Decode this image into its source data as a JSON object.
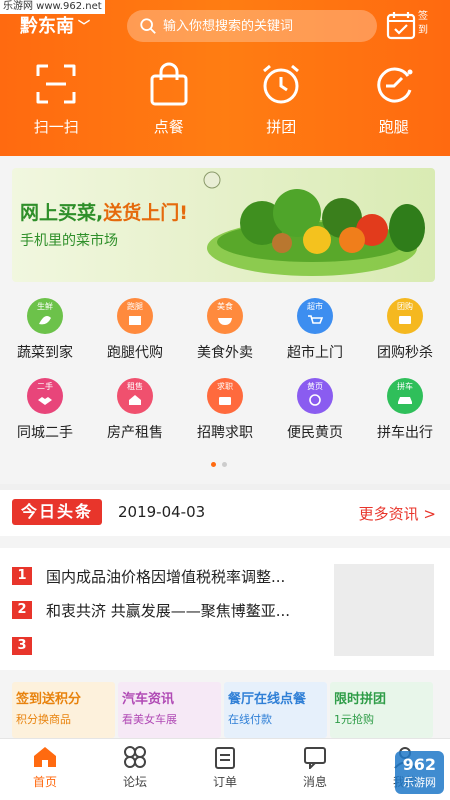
{
  "watermark": "乐游网 www.962.net",
  "header": {
    "city": "黔东南",
    "search_placeholder": "输入你想搜索的关键词",
    "signin_label": "签到",
    "quick_actions": [
      {
        "label": "扫一扫",
        "icon": "scan-icon"
      },
      {
        "label": "点餐",
        "icon": "shopping-bag-icon"
      },
      {
        "label": "拼团",
        "icon": "alarm-clock-icon"
      },
      {
        "label": "跑腿",
        "icon": "errand-icon"
      }
    ]
  },
  "banner": {
    "title_part1": "网上买菜,",
    "title_part2": "送货上门!",
    "subtitle": "手机里的菜市场"
  },
  "categories": [
    [
      {
        "label": "蔬菜到家",
        "tag": "生鲜",
        "color": "#6cc24a"
      },
      {
        "label": "跑腿代购",
        "tag": "跑腿",
        "color": "#ff8a3d"
      },
      {
        "label": "美食外卖",
        "tag": "美食",
        "color": "#ff8a3d"
      },
      {
        "label": "超市上门",
        "tag": "超市",
        "color": "#3d8ef0"
      },
      {
        "label": "团购秒杀",
        "tag": "团购",
        "color": "#f5b820"
      }
    ],
    [
      {
        "label": "同城二手",
        "tag": "二手",
        "color": "#e8457a"
      },
      {
        "label": "房产租售",
        "tag": "租售",
        "color": "#f0506e"
      },
      {
        "label": "招聘求职",
        "tag": "求职",
        "color": "#ff6a3d"
      },
      {
        "label": "便民黄页",
        "tag": "黄页",
        "color": "#8a5cf0"
      },
      {
        "label": "拼车出行",
        "tag": "拼车",
        "color": "#2fbf5a"
      }
    ]
  ],
  "news": {
    "logo_text": "今日头条",
    "date": "2019-04-03",
    "more_label": "更多资讯 >",
    "items": [
      {
        "num": "1",
        "text": "国内成品油价格因增值税税率调整..."
      },
      {
        "num": "2",
        "text": "和衷共济 共赢发展——聚焦博鳌亚..."
      },
      {
        "num": "3",
        "text": ""
      }
    ]
  },
  "promos": [
    {
      "title": "签到送积分",
      "sub": "积分换商品",
      "bg": "#fdf1dc",
      "fg": "#e8830e"
    },
    {
      "title": "汽车资讯",
      "sub": "看美女车展",
      "bg": "#f6e9f6",
      "fg": "#b04ab5"
    },
    {
      "title": "餐厅在线点餐",
      "sub": "在线付款",
      "bg": "#e6f0fb",
      "fg": "#2f7fd6"
    },
    {
      "title": "限时拼团",
      "sub": "1元抢购",
      "bg": "#e8f6ea",
      "fg": "#2f9d48"
    }
  ],
  "tabbar": [
    {
      "label": "首页",
      "active": true
    },
    {
      "label": "论坛",
      "active": false
    },
    {
      "label": "订单",
      "active": false
    },
    {
      "label": "消息",
      "active": false
    },
    {
      "label": "我的",
      "active": false
    }
  ],
  "corner_watermark": {
    "brand": "962",
    "site": "乐游网"
  },
  "colors": {
    "primary": "#ff6a10",
    "news_red": "#e8352b"
  }
}
